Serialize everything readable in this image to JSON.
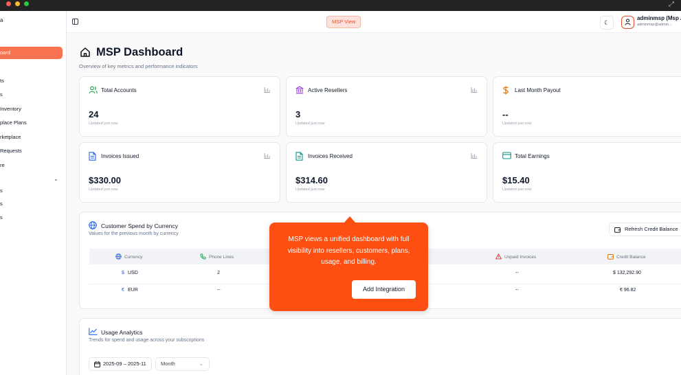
{
  "sidebar": {
    "brand": "a",
    "active_item": "oard",
    "items": [
      "ts",
      "s",
      "Inventory",
      "place Plans",
      "rketplace",
      "Requests",
      "re",
      "s",
      "s",
      "s"
    ]
  },
  "topbar": {
    "view_badge": "MSP View",
    "user_name": "adminmsp (Msp A",
    "user_email": "adminmsp@admin..."
  },
  "page": {
    "title": "MSP Dashboard",
    "subtitle": "Overview of key metrics and performance indicators"
  },
  "cards": [
    {
      "title": "Total Accounts",
      "value": "24",
      "updated": "Updated just now"
    },
    {
      "title": "Active Resellers",
      "value": "3",
      "updated": "Updated just now"
    },
    {
      "title": "Last Month Payout",
      "value": "--",
      "updated": "Updated just now"
    },
    {
      "title": "Invoices Issued",
      "value": "$330.00",
      "updated": "Updated just now"
    },
    {
      "title": "Invoices Received",
      "value": "$314.60",
      "updated": "Updated just now"
    },
    {
      "title": "Total Earnings",
      "value": "$15.40",
      "updated": "Updated just now"
    }
  ],
  "spend": {
    "title": "Customer Spend by Currency",
    "subtitle": "Values for the previous month by currency",
    "refresh_label": "Refresh Credit Balance",
    "columns": [
      "Currency",
      "Phone Lines",
      "Unpaid Invoices",
      "Credit Balance"
    ],
    "rows": [
      {
        "symbol": "$",
        "currency": "USD",
        "phone_lines": "2",
        "unpaid": "--",
        "credit": "$ 132,292.90"
      },
      {
        "symbol": "€",
        "currency": "EUR",
        "phone_lines": "--",
        "unpaid": "--",
        "credit": "€ 96.82"
      }
    ]
  },
  "tooltip": {
    "text": "MSP views a unified dashboard with full visibility into resellers, customers, plans, usage, and billing.",
    "button": "Add Integration"
  },
  "usage": {
    "title": "Usage Analytics",
    "subtitle": "Trends for spend and usage across your subscriptions",
    "date_range": "2025-09 – 2025-11",
    "period": "Month"
  },
  "colors": {
    "accent": "#fe4f12",
    "active_nav": "#f97350",
    "green": "#16a34a",
    "purple": "#9333ea",
    "amber": "#d97706",
    "blue": "#2563eb",
    "teal": "#0d9488"
  }
}
